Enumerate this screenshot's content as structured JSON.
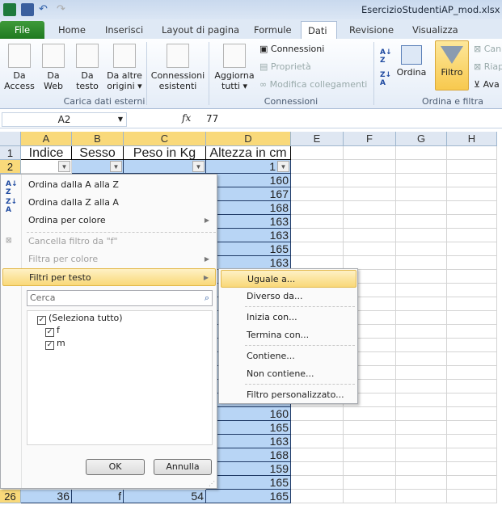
{
  "window": {
    "title": "EsercizioStudentiAP_mod.xlsx [m"
  },
  "tabs": [
    "File",
    "Home",
    "Inserisci",
    "Layout di pagina",
    "Formule",
    "Dati",
    "Revisione",
    "Visualizza"
  ],
  "active_tab": "Dati",
  "ribbon": {
    "carica": {
      "label": "Carica dati esterni",
      "access": "Da Access",
      "web": "Da Web",
      "testo": "Da testo",
      "altre": "Da altre origini ▾",
      "esistenti": "Connessioni esistenti"
    },
    "connessioni": {
      "label": "Connessioni",
      "aggiorna": "Aggiorna tutti ▾",
      "connessioni": "Connessioni",
      "proprieta": "Proprietà",
      "modifica": "Modifica collegamenti"
    },
    "ordina": {
      "label": "Ordina e filtra",
      "ordina": "Ordina",
      "filtro": "Filtro",
      "cancella": "Can",
      "riapplica": "Riap",
      "avanzate": "Ava"
    }
  },
  "formula_bar": {
    "name_box": "A2",
    "fx": "fx",
    "value": "77"
  },
  "columns": [
    "A",
    "B",
    "C",
    "D",
    "E",
    "F",
    "G",
    "H"
  ],
  "headers": [
    "Indice",
    "Sesso",
    "Peso in Kg",
    "Altezza in cm"
  ],
  "row2_d": "1",
  "column_d": {
    "rows_3_9": [
      "160",
      "167",
      "168",
      "163",
      "163",
      "165",
      "163"
    ],
    "rows_20_25": [
      "160",
      "165",
      "163",
      "168",
      "159",
      "165"
    ]
  },
  "row26": {
    "num": "26",
    "a": "36",
    "b": "f",
    "c": "54",
    "d": "165"
  },
  "menu": {
    "sort_az": "Ordina dalla A alla Z",
    "sort_za": "Ordina dalla Z alla A",
    "sort_color": "Ordina per colore",
    "clear": "Cancella filtro da \"f\"",
    "filter_color": "Filtra per colore",
    "text_filters": "Filtri per testo",
    "search_placeholder": "Cerca",
    "items": [
      "(Seleziona tutto)",
      "f",
      "m"
    ],
    "ok": "OK",
    "cancel": "Annulla"
  },
  "submenu": [
    "Uguale a...",
    "Diverso da...",
    "Inizia con...",
    "Termina con...",
    "Contiene...",
    "Non contiene...",
    "Filtro personalizzato..."
  ]
}
